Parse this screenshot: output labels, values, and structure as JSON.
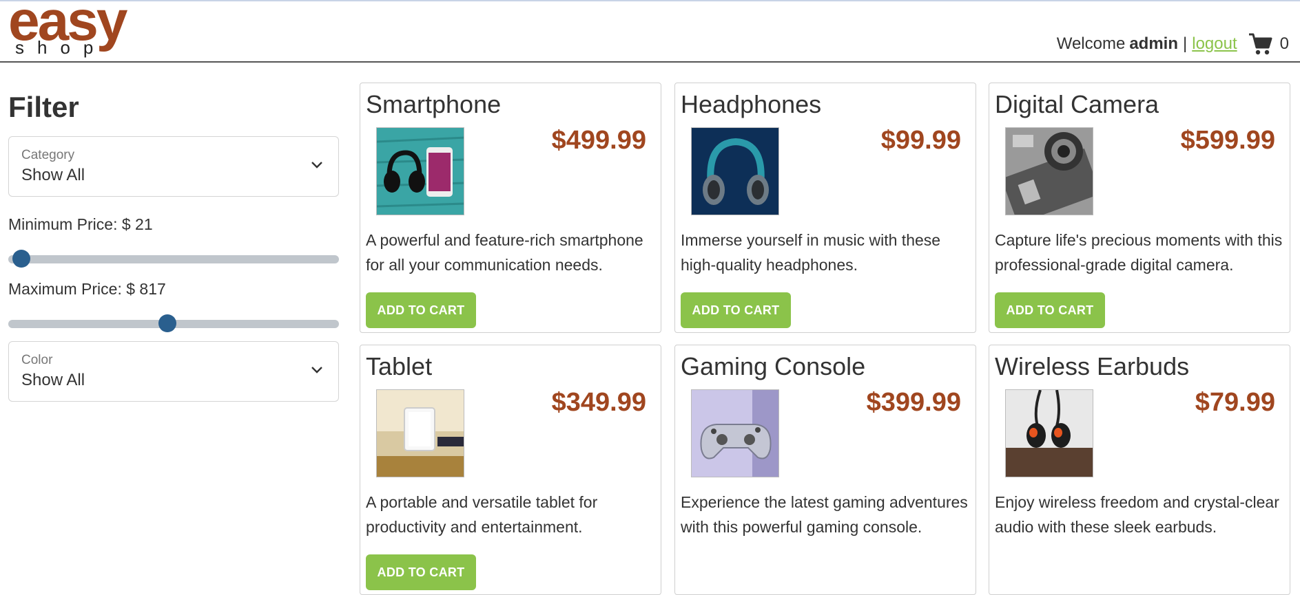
{
  "brand": {
    "logo_top": "easy",
    "logo_bottom": "shop"
  },
  "header": {
    "welcome": "Welcome",
    "username": "admin",
    "separator": "|",
    "logout": "logout",
    "cart_count": "0"
  },
  "filter": {
    "title": "Filter",
    "category": {
      "label": "Category",
      "value": "Show All"
    },
    "min_price": {
      "label": "Minimum Price: $ 21",
      "value": 21
    },
    "max_price": {
      "label": "Maximum Price: $ 817",
      "value": 817
    },
    "color": {
      "label": "Color",
      "value": "Show All"
    }
  },
  "products": [
    {
      "name": "Smartphone",
      "price": "$499.99",
      "description": "A powerful and feature-rich smartphone for all your communication needs.",
      "button": "ADD TO CART"
    },
    {
      "name": "Headphones",
      "price": "$99.99",
      "description": "Immerse yourself in music with these high-quality headphones.",
      "button": "ADD TO CART"
    },
    {
      "name": "Digital Camera",
      "price": "$599.99",
      "description": "Capture life's precious moments with this professional-grade digital camera.",
      "button": "ADD TO CART"
    },
    {
      "name": "Tablet",
      "price": "$349.99",
      "description": "A portable and versatile tablet for productivity and entertainment.",
      "button": "ADD TO CART"
    },
    {
      "name": "Gaming Console",
      "price": "$399.99",
      "description": "Experience the latest gaming adventures with this powerful gaming console.",
      "button": "ADD TO CART"
    },
    {
      "name": "Wireless Earbuds",
      "price": "$79.99",
      "description": "Enjoy wireless freedom and crystal-clear audio with these sleek earbuds.",
      "button": "ADD TO CART"
    }
  ],
  "icons": {
    "cart": "cart-icon",
    "chevron": "chevron-down-icon"
  },
  "colors": {
    "brand": "#a0461f",
    "accent_green": "#8bc34a",
    "slider_thumb": "#2a5f8e"
  }
}
